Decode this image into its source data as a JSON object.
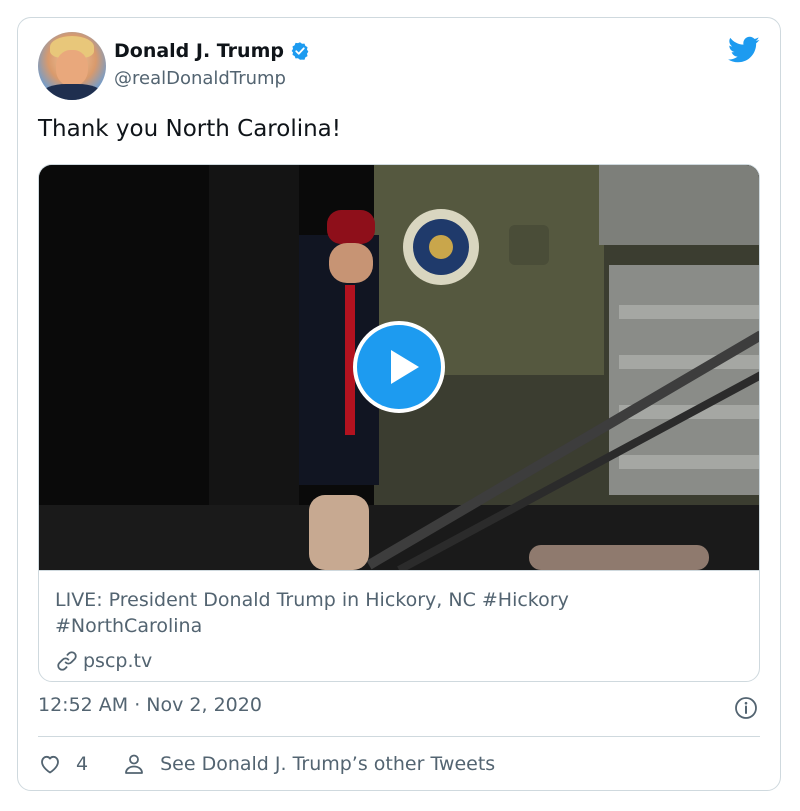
{
  "author": {
    "name": "Donald J. Trump",
    "handle": "@realDonaldTrump",
    "verified_icon": "verified-badge-icon",
    "avatar": "profile-avatar"
  },
  "brand": {
    "icon": "twitter-bird-icon",
    "color": "#1d9bf0"
  },
  "tweet": {
    "text": "Thank you North Carolina!",
    "timestamp": "12:52 AM · Nov 2, 2020"
  },
  "media_card": {
    "title": "LIVE: President Donald Trump in Hickory, NC #Hickory #NorthCarolina",
    "domain": "pscp.tv",
    "play_icon": "play-icon"
  },
  "actions": {
    "like_count": "4",
    "other_tweets_label": "See Donald J. Trump’s other Tweets"
  },
  "colors": {
    "text_primary": "#0f1419",
    "text_secondary": "#536471",
    "border": "#cfd9de",
    "accent": "#1d9bf0"
  }
}
